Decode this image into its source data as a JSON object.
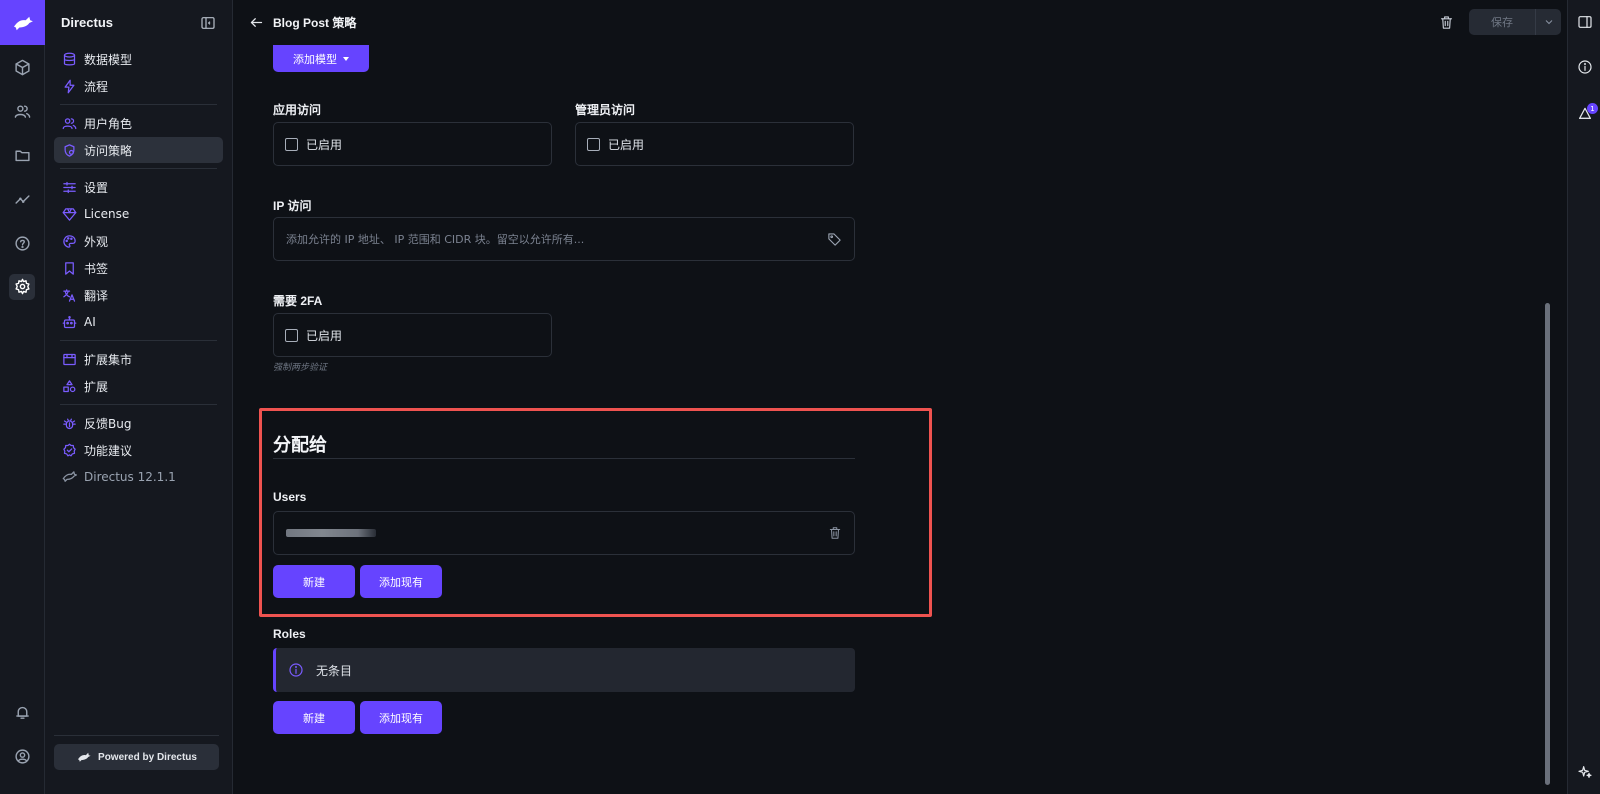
{
  "app": {
    "name": "Directus"
  },
  "header": {
    "title": "Blog Post 策略",
    "save_label": "保存"
  },
  "rail": {
    "items": [
      {
        "icon": "cube-icon"
      },
      {
        "icon": "users-icon"
      },
      {
        "icon": "folder-icon"
      },
      {
        "icon": "insights-icon"
      },
      {
        "icon": "help-icon"
      },
      {
        "icon": "settings-icon"
      }
    ],
    "bottom": [
      {
        "icon": "bell-icon"
      },
      {
        "icon": "account-icon"
      }
    ]
  },
  "nav": {
    "groups": [
      [
        {
          "label": "数据模型",
          "icon": "database-icon"
        },
        {
          "label": "流程",
          "icon": "bolt-icon"
        }
      ],
      [
        {
          "label": "用户角色",
          "icon": "users-icon"
        },
        {
          "label": "访问策略",
          "icon": "policy-icon",
          "active": true
        }
      ],
      [
        {
          "label": "设置",
          "icon": "sliders-icon"
        },
        {
          "label": "License",
          "icon": "diamond-icon"
        },
        {
          "label": "外观",
          "icon": "palette-icon"
        },
        {
          "label": "书签",
          "icon": "bookmark-icon"
        },
        {
          "label": "翻译",
          "icon": "translate-icon"
        },
        {
          "label": "AI",
          "icon": "robot-icon"
        }
      ],
      [
        {
          "label": "扩展集市",
          "icon": "store-icon"
        },
        {
          "label": "扩展",
          "icon": "extensions-icon"
        }
      ],
      [
        {
          "label": "反馈Bug",
          "icon": "bug-icon"
        },
        {
          "label": "功能建议",
          "icon": "check-badge-icon"
        },
        {
          "label": "Directus 12.1.1",
          "icon": "directus-logo-icon"
        }
      ]
    ],
    "footer_label": "Powered by Directus"
  },
  "form": {
    "add_model_label": "添加模型",
    "app_access": {
      "label": "应用访问",
      "checkbox_label": "已启用",
      "checked": false
    },
    "admin_access": {
      "label": "管理员访问",
      "checkbox_label": "已启用",
      "checked": false
    },
    "ip_access": {
      "label": "IP 访问",
      "placeholder": "添加允许的 IP 地址、 IP 范围和 CIDR 块。留空以允许所有..."
    },
    "require_2fa": {
      "label": "需要 2FA",
      "checkbox_label": "已启用",
      "checked": false,
      "hint": "强制两步验证"
    }
  },
  "assign": {
    "section_title": "分配给",
    "users": {
      "label": "Users",
      "new_label": "新建",
      "add_existing_label": "添加现有"
    },
    "roles": {
      "label": "Roles",
      "empty_label": "无条目",
      "new_label": "新建",
      "add_existing_label": "添加现有"
    }
  },
  "right_rail": {
    "notification_count": "1"
  },
  "colors": {
    "accent": "#6644ff",
    "background": "#0e1116",
    "panel": "#15181f",
    "highlight": "#ef5350"
  }
}
